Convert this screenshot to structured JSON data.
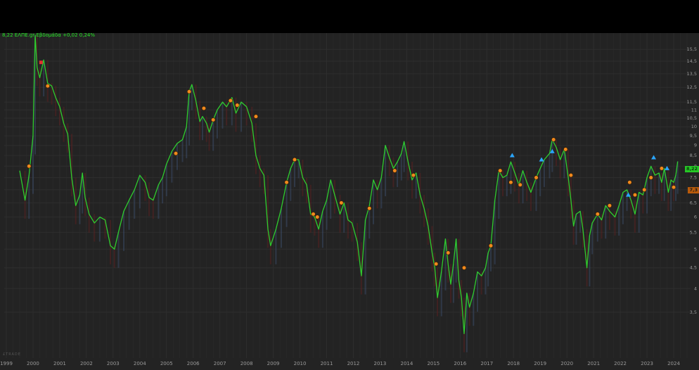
{
  "header": {
    "quote_text": "8,22 ΕΛΠΕ.gr Εβδομάδα +0,02 0,24%",
    "watermark": "£TRADE"
  },
  "price_badge": "8,22",
  "secondary_badge": "7,3",
  "colors": {
    "background": "#232323",
    "grid": "#2e2e2e",
    "price_line": "#2ecc2e",
    "marker_orange": "#f0891e",
    "marker_blue": "#2aa6ff",
    "marker_red": "#e03030",
    "up_volume": "#3a4a66",
    "down_volume": "#5a2020"
  },
  "chart_data": {
    "type": "line",
    "title": "",
    "xlabel": "",
    "ylabel": "",
    "y_scale": "log",
    "ylim": [
      2.7,
      17
    ],
    "grid": true,
    "x_tick_labels": [
      "1999",
      "2000",
      "2001",
      "2002",
      "2003",
      "2004",
      "2005",
      "2006",
      "2007",
      "2008",
      "2009",
      "2010",
      "2011",
      "2012",
      "2013",
      "2014",
      "2015",
      "2016",
      "2017",
      "2018",
      "2019",
      "2020",
      "2021",
      "2022",
      "2023",
      "2024"
    ],
    "y_tick_labels": [
      "15,5",
      "14,5",
      "13,5",
      "12,5",
      "11,5",
      "11",
      "10,5",
      "10",
      "9,5",
      "9",
      "8,5",
      "8",
      "7,5",
      "7",
      "6,5",
      "6",
      "5,5",
      "5",
      "4,5",
      "4",
      "3,5"
    ],
    "series": [
      {
        "values": [
          [
            1999.5,
            7.8
          ],
          [
            1999.7,
            6.6
          ],
          [
            1999.85,
            7.6
          ],
          [
            2000.0,
            9.5
          ],
          [
            2000.08,
            16.8
          ],
          [
            2000.15,
            14.0
          ],
          [
            2000.25,
            13.2
          ],
          [
            2000.4,
            14.6
          ],
          [
            2000.55,
            12.8
          ],
          [
            2000.7,
            12.6
          ],
          [
            2000.85,
            11.8
          ],
          [
            2001.0,
            11.2
          ],
          [
            2001.15,
            10.2
          ],
          [
            2001.3,
            9.6
          ],
          [
            2001.45,
            7.5
          ],
          [
            2001.6,
            6.4
          ],
          [
            2001.75,
            6.8
          ],
          [
            2001.85,
            7.7
          ],
          [
            2001.95,
            6.7
          ],
          [
            2002.1,
            6.1
          ],
          [
            2002.3,
            5.8
          ],
          [
            2002.5,
            6.0
          ],
          [
            2002.7,
            5.9
          ],
          [
            2002.9,
            5.1
          ],
          [
            2003.05,
            5.0
          ],
          [
            2003.2,
            5.5
          ],
          [
            2003.4,
            6.2
          ],
          [
            2003.6,
            6.6
          ],
          [
            2003.8,
            7.0
          ],
          [
            2004.0,
            7.6
          ],
          [
            2004.2,
            7.3
          ],
          [
            2004.35,
            6.7
          ],
          [
            2004.5,
            6.6
          ],
          [
            2004.7,
            7.2
          ],
          [
            2004.85,
            7.5
          ],
          [
            2005.0,
            8.1
          ],
          [
            2005.2,
            8.7
          ],
          [
            2005.4,
            9.1
          ],
          [
            2005.6,
            9.3
          ],
          [
            2005.75,
            10.0
          ],
          [
            2005.85,
            12.2
          ],
          [
            2005.95,
            12.7
          ],
          [
            2006.1,
            11.6
          ],
          [
            2006.25,
            10.3
          ],
          [
            2006.35,
            10.6
          ],
          [
            2006.5,
            10.2
          ],
          [
            2006.6,
            9.7
          ],
          [
            2006.75,
            10.4
          ],
          [
            2006.9,
            11.0
          ],
          [
            2007.1,
            11.5
          ],
          [
            2007.25,
            11.2
          ],
          [
            2007.45,
            11.8
          ],
          [
            2007.6,
            10.8
          ],
          [
            2007.8,
            11.5
          ],
          [
            2008.0,
            11.2
          ],
          [
            2008.2,
            10.2
          ],
          [
            2008.35,
            8.5
          ],
          [
            2008.5,
            7.9
          ],
          [
            2008.65,
            7.6
          ],
          [
            2008.8,
            5.6
          ],
          [
            2008.9,
            5.1
          ],
          [
            2009.1,
            5.6
          ],
          [
            2009.3,
            6.3
          ],
          [
            2009.5,
            7.3
          ],
          [
            2009.65,
            7.9
          ],
          [
            2009.8,
            8.3
          ],
          [
            2009.95,
            8.3
          ],
          [
            2010.1,
            7.5
          ],
          [
            2010.25,
            7.2
          ],
          [
            2010.4,
            6.1
          ],
          [
            2010.55,
            6.0
          ],
          [
            2010.7,
            5.6
          ],
          [
            2010.85,
            6.2
          ],
          [
            2011.0,
            6.6
          ],
          [
            2011.15,
            7.4
          ],
          [
            2011.3,
            6.8
          ],
          [
            2011.5,
            6.1
          ],
          [
            2011.65,
            6.5
          ],
          [
            2011.8,
            5.9
          ],
          [
            2011.95,
            5.8
          ],
          [
            2012.15,
            5.2
          ],
          [
            2012.3,
            4.3
          ],
          [
            2012.45,
            5.9
          ],
          [
            2012.6,
            6.4
          ],
          [
            2012.75,
            7.4
          ],
          [
            2012.9,
            7.0
          ],
          [
            2013.05,
            7.5
          ],
          [
            2013.2,
            9.0
          ],
          [
            2013.35,
            8.4
          ],
          [
            2013.5,
            7.9
          ],
          [
            2013.65,
            8.2
          ],
          [
            2013.8,
            8.6
          ],
          [
            2013.9,
            9.2
          ],
          [
            2014.05,
            8.2
          ],
          [
            2014.2,
            7.4
          ],
          [
            2014.35,
            7.7
          ],
          [
            2014.5,
            6.8
          ],
          [
            2014.65,
            6.3
          ],
          [
            2014.8,
            5.7
          ],
          [
            2014.95,
            4.9
          ],
          [
            2015.05,
            4.5
          ],
          [
            2015.15,
            3.8
          ],
          [
            2015.3,
            4.4
          ],
          [
            2015.45,
            5.3
          ],
          [
            2015.55,
            4.6
          ],
          [
            2015.65,
            4.1
          ],
          [
            2015.75,
            4.6
          ],
          [
            2015.85,
            5.3
          ],
          [
            2015.95,
            4.2
          ],
          [
            2016.05,
            3.8
          ],
          [
            2016.15,
            3.1
          ],
          [
            2016.25,
            3.9
          ],
          [
            2016.35,
            3.6
          ],
          [
            2016.5,
            3.9
          ],
          [
            2016.65,
            4.4
          ],
          [
            2016.8,
            4.3
          ],
          [
            2016.95,
            4.5
          ],
          [
            2017.05,
            4.9
          ],
          [
            2017.15,
            5.1
          ],
          [
            2017.3,
            6.6
          ],
          [
            2017.45,
            7.8
          ],
          [
            2017.6,
            7.5
          ],
          [
            2017.75,
            7.6
          ],
          [
            2017.9,
            8.2
          ],
          [
            2018.05,
            7.7
          ],
          [
            2018.2,
            7.2
          ],
          [
            2018.35,
            7.8
          ],
          [
            2018.5,
            7.3
          ],
          [
            2018.65,
            6.9
          ],
          [
            2018.85,
            7.5
          ],
          [
            2019.0,
            7.9
          ],
          [
            2019.15,
            8.3
          ],
          [
            2019.35,
            8.6
          ],
          [
            2019.45,
            9.3
          ],
          [
            2019.6,
            8.9
          ],
          [
            2019.75,
            8.3
          ],
          [
            2019.9,
            8.8
          ],
          [
            2020.05,
            7.5
          ],
          [
            2020.15,
            6.6
          ],
          [
            2020.25,
            5.7
          ],
          [
            2020.35,
            6.1
          ],
          [
            2020.5,
            6.2
          ],
          [
            2020.6,
            5.6
          ],
          [
            2020.75,
            4.5
          ],
          [
            2020.85,
            5.4
          ],
          [
            2020.95,
            5.8
          ],
          [
            2021.15,
            6.1
          ],
          [
            2021.3,
            5.9
          ],
          [
            2021.45,
            6.4
          ],
          [
            2021.6,
            6.2
          ],
          [
            2021.8,
            6.0
          ],
          [
            2021.95,
            6.4
          ],
          [
            2022.1,
            6.9
          ],
          [
            2022.25,
            7.0
          ],
          [
            2022.4,
            6.6
          ],
          [
            2022.55,
            6.1
          ],
          [
            2022.7,
            6.9
          ],
          [
            2022.85,
            6.8
          ],
          [
            2023.0,
            7.5
          ],
          [
            2023.15,
            8.0
          ],
          [
            2023.3,
            7.6
          ],
          [
            2023.45,
            7.7
          ],
          [
            2023.55,
            7.3
          ],
          [
            2023.65,
            7.9
          ],
          [
            2023.8,
            6.9
          ],
          [
            2023.9,
            7.4
          ],
          [
            2024.0,
            7.3
          ],
          [
            2024.08,
            7.6
          ],
          [
            2024.15,
            8.22
          ]
        ]
      }
    ]
  },
  "markers": {
    "orange": [
      [
        1999.85,
        8.0
      ],
      [
        2000.55,
        12.6
      ],
      [
        2005.35,
        8.6
      ],
      [
        2005.85,
        12.2
      ],
      [
        2006.4,
        11.1
      ],
      [
        2006.75,
        10.4
      ],
      [
        2007.4,
        11.6
      ],
      [
        2007.65,
        11.3
      ],
      [
        2008.35,
        10.6
      ],
      [
        2009.8,
        8.3
      ],
      [
        2009.5,
        7.3
      ],
      [
        2010.5,
        6.1
      ],
      [
        2010.65,
        6.0
      ],
      [
        2011.55,
        6.5
      ],
      [
        2012.6,
        6.3
      ],
      [
        2013.55,
        7.8
      ],
      [
        2014.25,
        7.6
      ],
      [
        2015.1,
        4.6
      ],
      [
        2015.55,
        4.9
      ],
      [
        2016.15,
        4.5
      ],
      [
        2017.15,
        5.1
      ],
      [
        2017.5,
        7.8
      ],
      [
        2017.9,
        7.3
      ],
      [
        2018.25,
        7.2
      ],
      [
        2018.85,
        7.5
      ],
      [
        2019.5,
        9.3
      ],
      [
        2019.95,
        8.8
      ],
      [
        2020.15,
        7.6
      ],
      [
        2021.15,
        6.1
      ],
      [
        2021.6,
        6.4
      ],
      [
        2022.35,
        7.3
      ],
      [
        2022.55,
        6.8
      ],
      [
        2022.9,
        7.0
      ],
      [
        2023.15,
        7.5
      ],
      [
        2023.55,
        7.9
      ],
      [
        2024.0,
        7.1
      ]
    ],
    "blue": [
      [
        2017.95,
        8.5
      ],
      [
        2019.05,
        8.3
      ],
      [
        2019.45,
        8.7
      ],
      [
        2022.3,
        6.8
      ],
      [
        2023.25,
        8.4
      ],
      [
        2023.75,
        7.9
      ]
    ],
    "red": [
      [
        2000.3,
        14.4
      ]
    ]
  }
}
